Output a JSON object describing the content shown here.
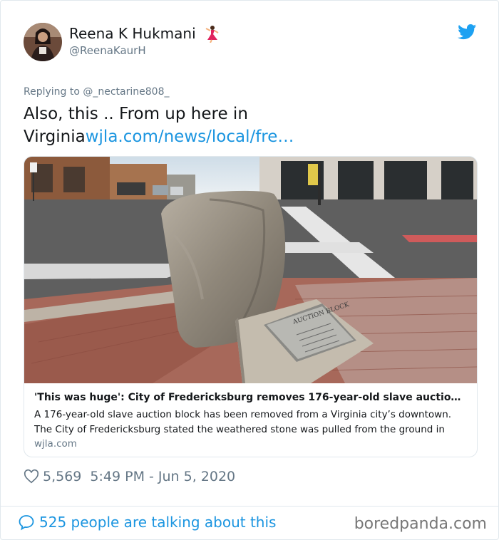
{
  "author": {
    "name": "Reena K Hukmani",
    "handle": "@ReenaKaurH"
  },
  "tweet": {
    "replying_to": "Replying to @_nectarine808_",
    "text_line1": "Also, this .. From up here in",
    "text_line2_prefix": "Virginia",
    "link": "wjla.com/news/local/fre…"
  },
  "card": {
    "headline": "'This was huge': City of Fredericksburg removes 176-year-old slave auctio…",
    "description_line1": "A 176-year-old slave auction block has been removed from a Virginia city’s downtown.",
    "description_line2": "The City of Fredericksburg stated the weathered stone was pulled from the ground in",
    "domain": "wjla.com",
    "plaque_text": "AUCTION BLOCK"
  },
  "meta": {
    "likes": "5,569",
    "timestamp": "5:49 PM - Jun 5, 2020"
  },
  "footer": {
    "talking": "525 people are talking about this",
    "watermark": "boredpanda.com"
  },
  "icons": {
    "bird": "twitter-bird-icon",
    "heart": "heart-icon",
    "speech": "speech-bubble-icon",
    "emoji": "dancer-emoji-icon"
  },
  "colors": {
    "link": "#1b95e0",
    "secondary": "#657786",
    "border": "#e1e8ed"
  }
}
